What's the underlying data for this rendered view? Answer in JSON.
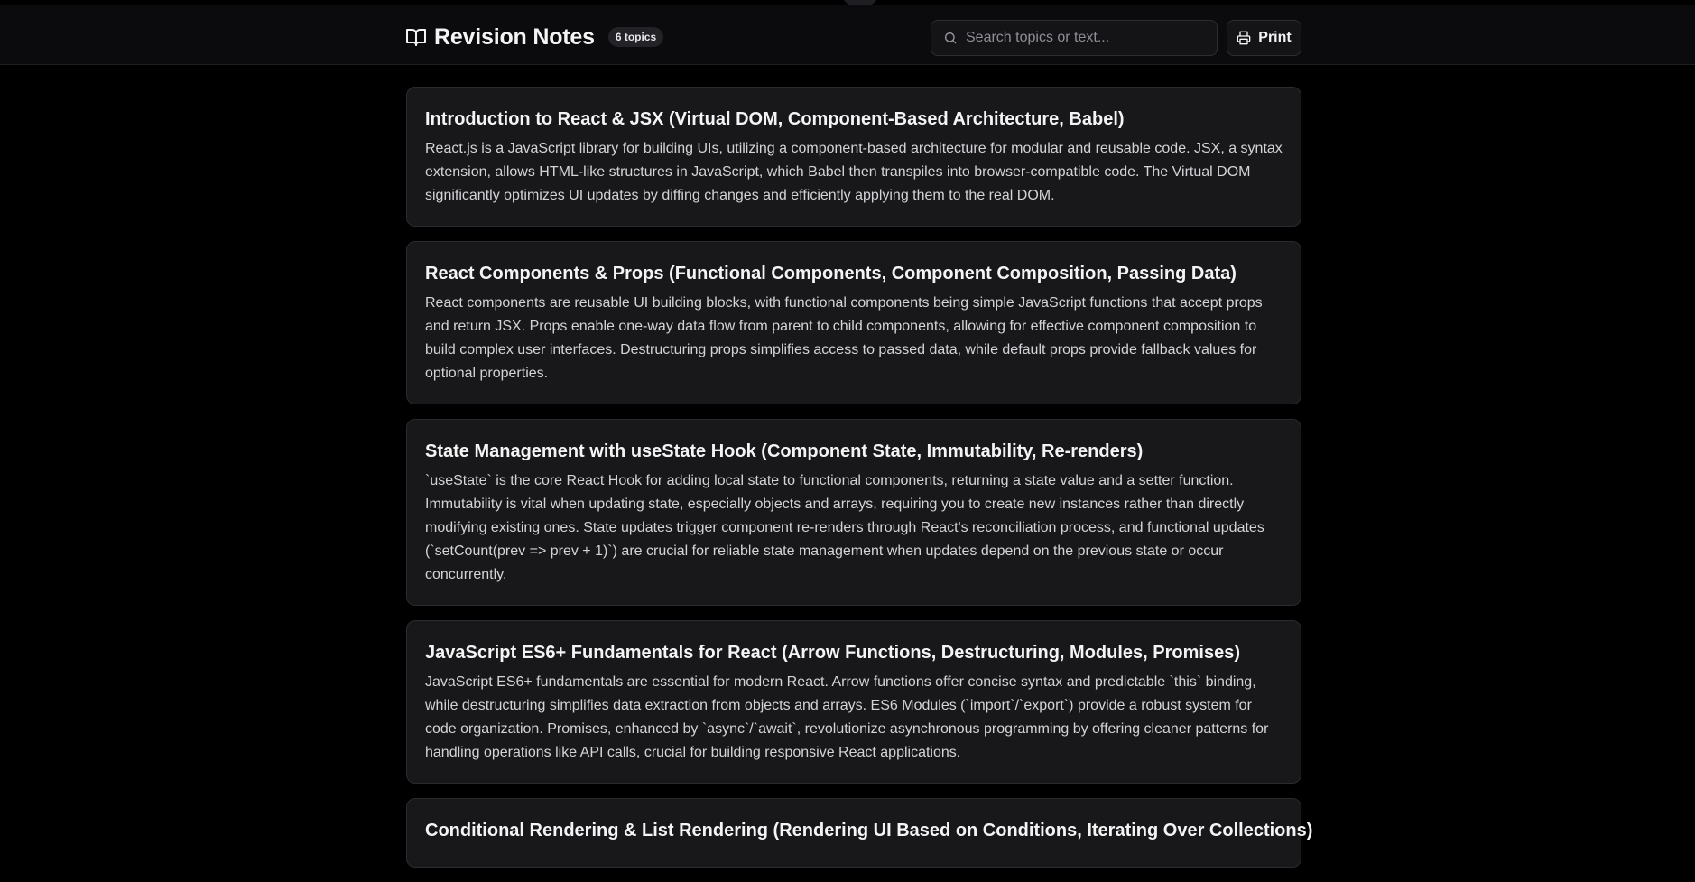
{
  "header": {
    "title": "Revision Notes",
    "topic_count": "6 topics",
    "search_placeholder": "Search topics or text...",
    "print_label": "Print",
    "icons": {
      "brand": "open-book-icon",
      "search": "search-icon",
      "print": "printer-icon"
    }
  },
  "colors": {
    "background": "#000000",
    "card": "#18181b",
    "text": "#e7e7e9"
  },
  "topics": [
    {
      "title": "Introduction to React & JSX (Virtual DOM, Component-Based Architecture, Babel)",
      "body": "React.js is a JavaScript library for building UIs, utilizing a component-based architecture for modular and reusable code. JSX, a syntax extension, allows HTML-like structures in JavaScript, which Babel then transpiles into browser-compatible code. The Virtual DOM significantly optimizes UI updates by diffing changes and efficiently applying them to the real DOM."
    },
    {
      "title": "React Components & Props (Functional Components, Component Composition, Passing Data)",
      "body": "React components are reusable UI building blocks, with functional components being simple JavaScript functions that accept props and return JSX. Props enable one-way data flow from parent to child components, allowing for effective component composition to build complex user interfaces. Destructuring props simplifies access to passed data, while default props provide fallback values for optional properties."
    },
    {
      "title": "State Management with useState Hook (Component State, Immutability, Re-renders)",
      "body": "`useState` is the core React Hook for adding local state to functional components, returning a state value and a setter function. Immutability is vital when updating state, especially objects and arrays, requiring you to create new instances rather than directly modifying existing ones. State updates trigger component re-renders through React's reconciliation process, and functional updates (`setCount(prev => prev + 1)`) are crucial for reliable state management when updates depend on the previous state or occur concurrently."
    },
    {
      "title": "JavaScript ES6+ Fundamentals for React (Arrow Functions, Destructuring, Modules, Promises)",
      "body": "JavaScript ES6+ fundamentals are essential for modern React. Arrow functions offer concise syntax and predictable `this` binding, while destructuring simplifies data extraction from objects and arrays. ES6 Modules (`import`/`export`) provide a robust system for code organization. Promises, enhanced by `async`/`await`, revolutionize asynchronous programming by offering cleaner patterns for handling operations like API calls, crucial for building responsive React applications."
    },
    {
      "title": "Conditional Rendering & List Rendering (Rendering UI Based on Conditions, Iterating Over Collections)",
      "body": ""
    }
  ]
}
